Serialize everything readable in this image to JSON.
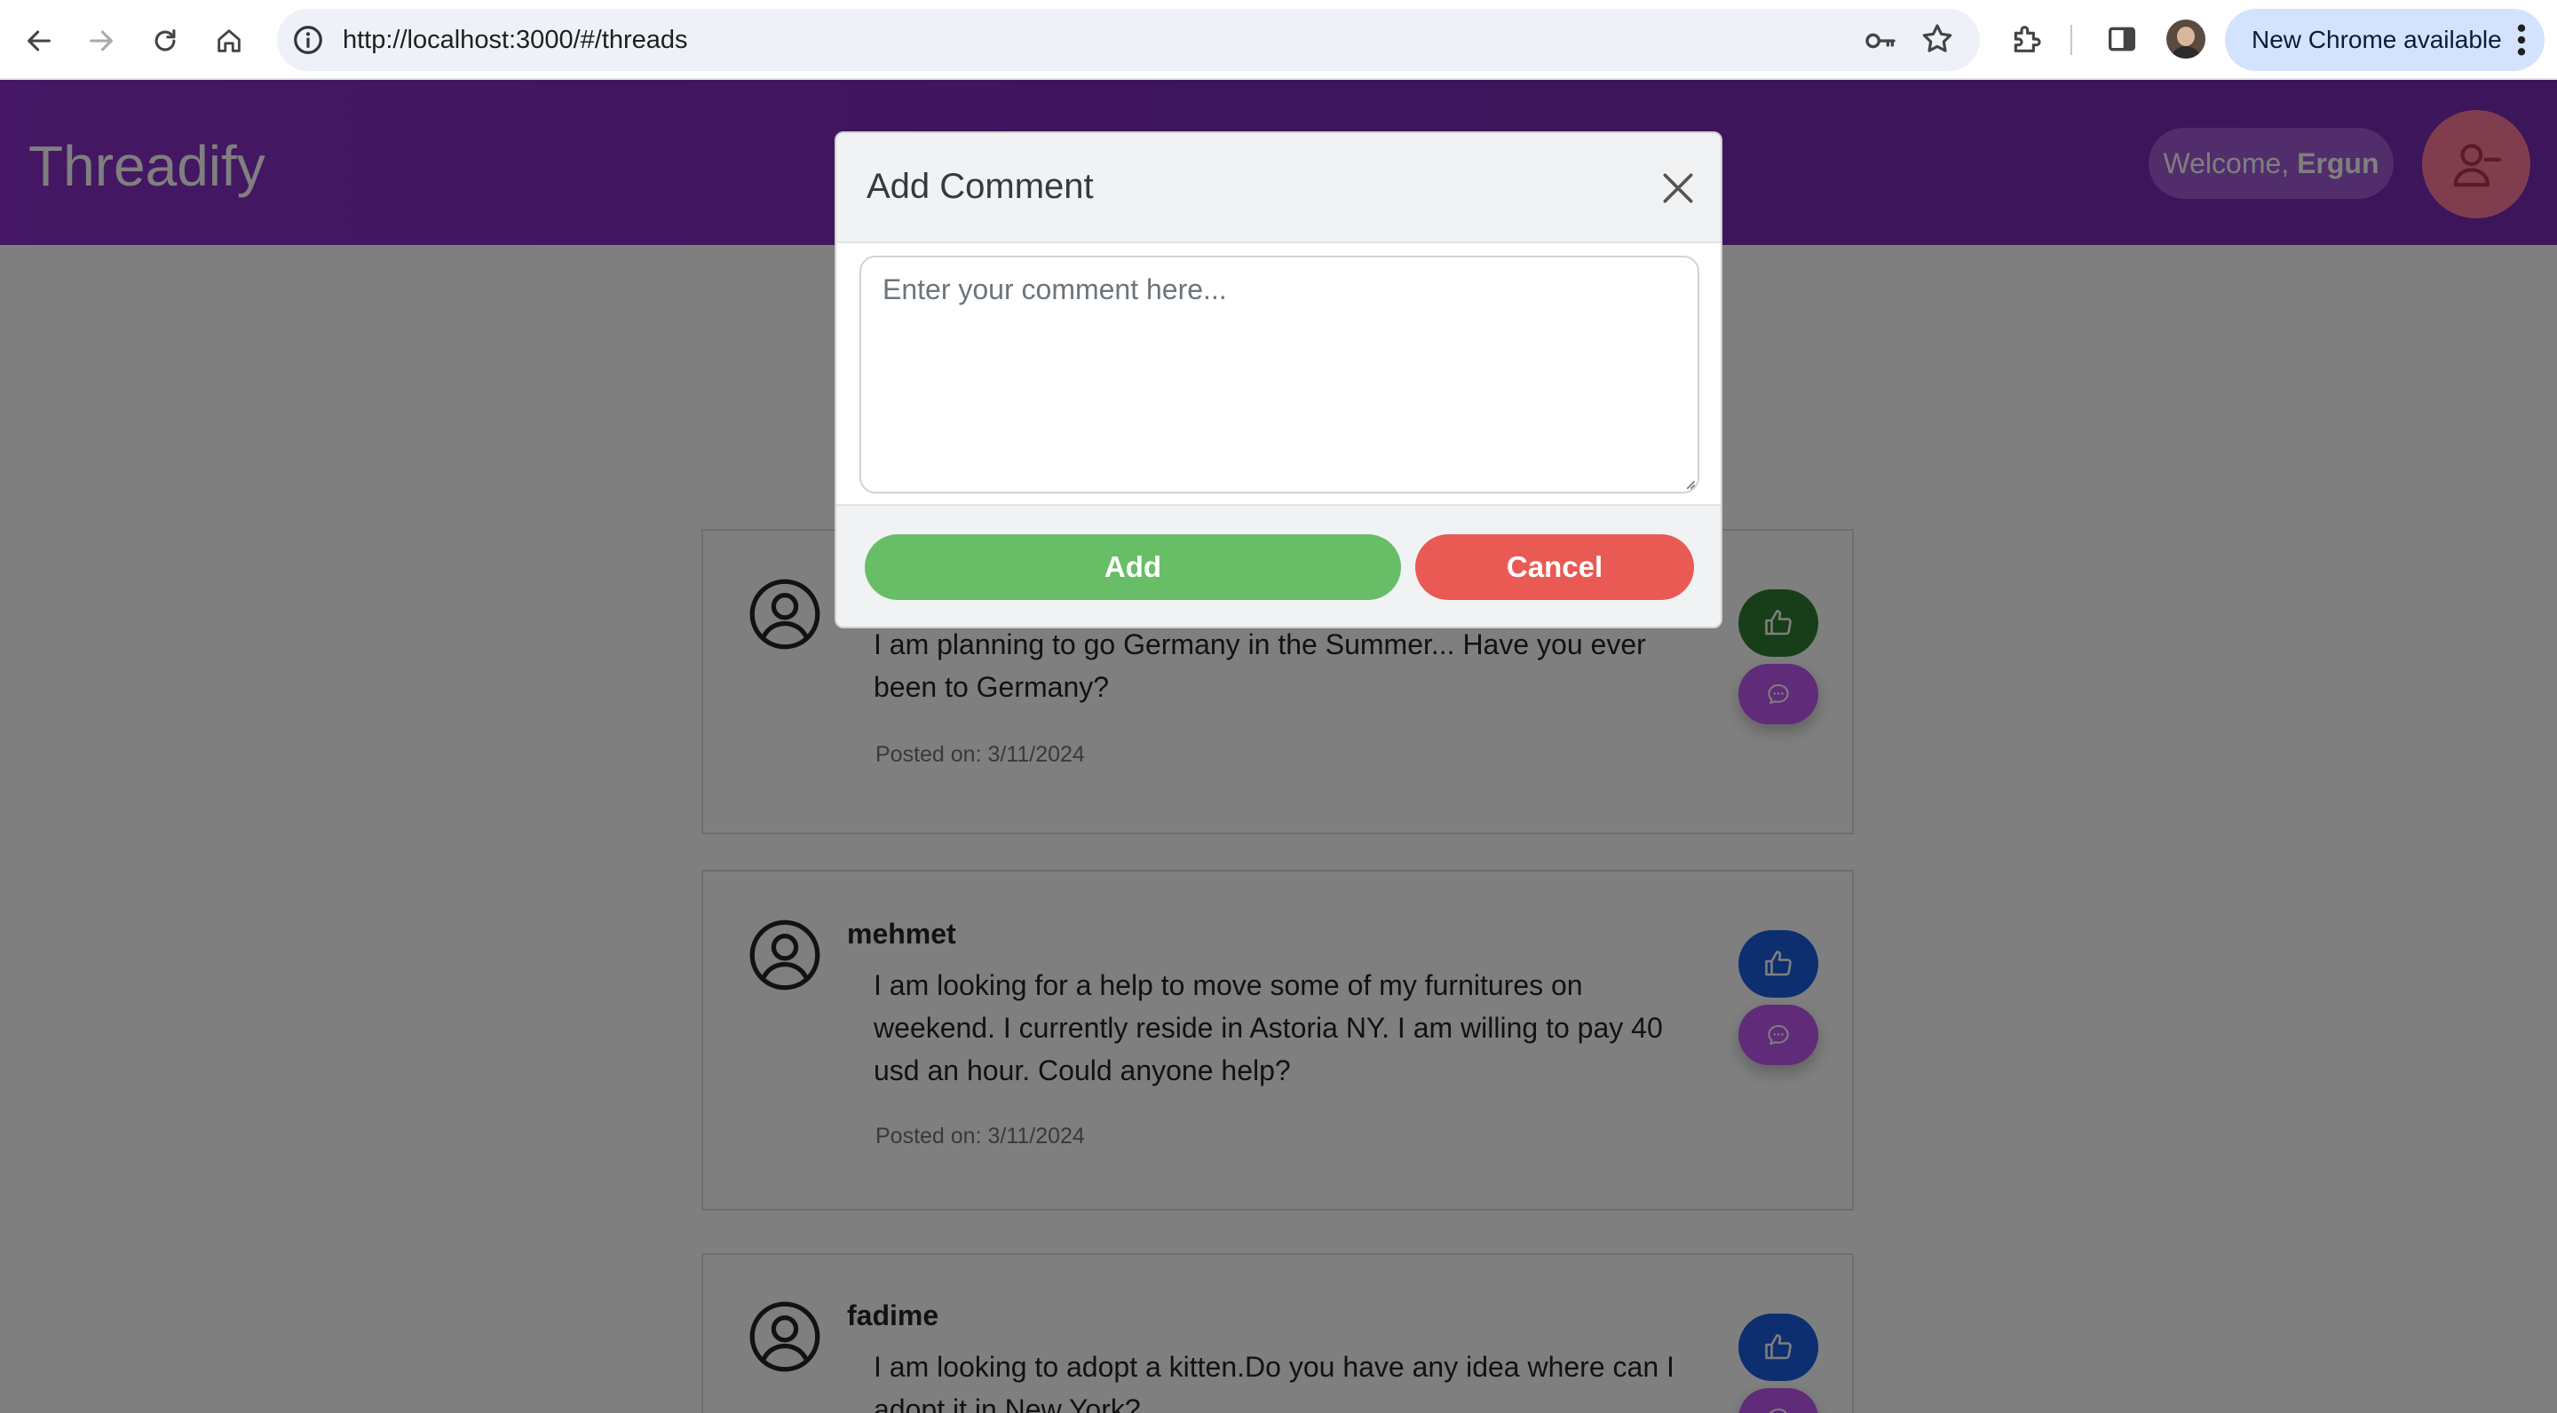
{
  "browser": {
    "url": "http://localhost:3000/#/threads",
    "update_label": "New Chrome available"
  },
  "header": {
    "brand": "Threadify",
    "welcome_prefix": "Welcome, ",
    "user_name": "Ergun"
  },
  "threads": [
    {
      "author": "",
      "text": "I am planning to go Germany in the Summer... Have you ever been to Germany?",
      "date": "Posted on: 3/11/2024",
      "liked": true
    },
    {
      "author": "mehmet",
      "text": "I am looking for a help to move some of my furnitures on weekend. I currently reside in Astoria NY. I am willing to pay 40 usd an hour. Could anyone help?",
      "date": "Posted on: 3/11/2024",
      "liked": false
    },
    {
      "author": "fadime",
      "text": "I am looking to adopt a kitten.Do you have any idea where can I adopt it in New York?",
      "date": "",
      "liked": false
    }
  ],
  "modal": {
    "title": "Add Comment",
    "placeholder": "Enter your comment here...",
    "add_label": "Add",
    "cancel_label": "Cancel"
  },
  "colors": {
    "header": "#7a2ab8",
    "like_active": "#2e7d32",
    "like_default": "#1a5fe0",
    "comment_button": "#c156f0",
    "add_button": "#67be67",
    "cancel_button": "#e95a54"
  },
  "icons": [
    "back-arrow-icon",
    "forward-arrow-icon",
    "reload-icon",
    "home-icon",
    "site-info-icon",
    "password-key-icon",
    "bookmark-star-icon",
    "extensions-icon",
    "side-panel-icon",
    "more-vert-icon",
    "user-minus-icon",
    "user-circle-icon",
    "thumbs-up-icon",
    "chat-bubble-icon",
    "close-icon"
  ]
}
